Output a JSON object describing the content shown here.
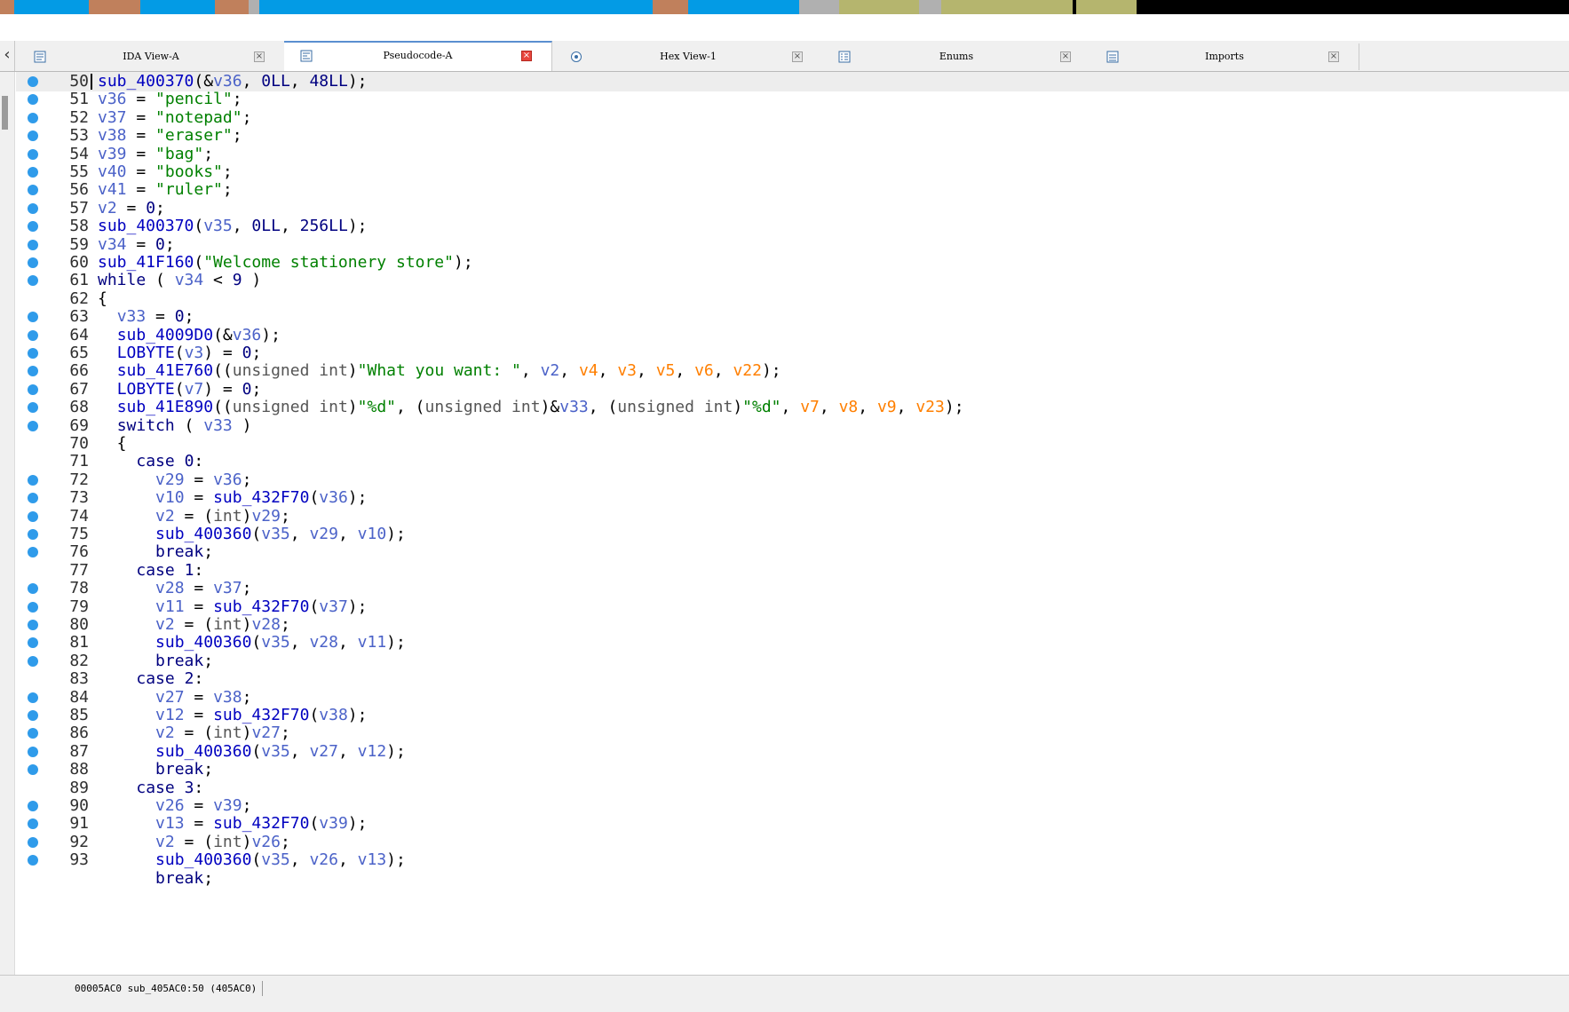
{
  "colors": {
    "nav_blue": "#039be5",
    "nav_brown": "#c0805c",
    "nav_olive": "#b5b56e",
    "nav_gray": "#b0b0b0",
    "nav_black": "#000000",
    "breakpoint_dot": "#2f9bea",
    "string": "#008000",
    "variable": "#4b62c8",
    "register_var": "#ff7f00"
  },
  "tabs": [
    {
      "label": "IDA View-A",
      "icon": "disassembly-icon",
      "active": false
    },
    {
      "label": "Pseudocode-A",
      "icon": "pseudocode-icon",
      "active": true
    },
    {
      "label": "Hex View-1",
      "icon": "hex-view-icon",
      "active": false
    },
    {
      "label": "Enums",
      "icon": "enums-icon",
      "active": false
    },
    {
      "label": "Imports",
      "icon": "imports-icon",
      "active": false
    }
  ],
  "code_lines": [
    {
      "n": "50",
      "dot": true,
      "tokens": [
        [
          "fn",
          "sub_400370"
        ],
        [
          "op",
          "(&"
        ],
        [
          "var",
          "v36"
        ],
        [
          "op",
          ", "
        ],
        [
          "num",
          "0LL"
        ],
        [
          "op",
          ", "
        ],
        [
          "num",
          "48LL"
        ],
        [
          "op",
          ");"
        ]
      ]
    },
    {
      "n": "51",
      "dot": true,
      "tokens": [
        [
          "var",
          "v36"
        ],
        [
          "op",
          " = "
        ],
        [
          "str",
          "\"pencil\""
        ],
        [
          "op",
          ";"
        ]
      ]
    },
    {
      "n": "52",
      "dot": true,
      "tokens": [
        [
          "var",
          "v37"
        ],
        [
          "op",
          " = "
        ],
        [
          "str",
          "\"notepad\""
        ],
        [
          "op",
          ";"
        ]
      ]
    },
    {
      "n": "53",
      "dot": true,
      "tokens": [
        [
          "var",
          "v38"
        ],
        [
          "op",
          " = "
        ],
        [
          "str",
          "\"eraser\""
        ],
        [
          "op",
          ";"
        ]
      ]
    },
    {
      "n": "54",
      "dot": true,
      "tokens": [
        [
          "var",
          "v39"
        ],
        [
          "op",
          " = "
        ],
        [
          "str",
          "\"bag\""
        ],
        [
          "op",
          ";"
        ]
      ]
    },
    {
      "n": "55",
      "dot": true,
      "tokens": [
        [
          "var",
          "v40"
        ],
        [
          "op",
          " = "
        ],
        [
          "str",
          "\"books\""
        ],
        [
          "op",
          ";"
        ]
      ]
    },
    {
      "n": "56",
      "dot": true,
      "tokens": [
        [
          "var",
          "v41"
        ],
        [
          "op",
          " = "
        ],
        [
          "str",
          "\"ruler\""
        ],
        [
          "op",
          ";"
        ]
      ]
    },
    {
      "n": "57",
      "dot": true,
      "tokens": [
        [
          "var",
          "v2"
        ],
        [
          "op",
          " = "
        ],
        [
          "num",
          "0"
        ],
        [
          "op",
          ";"
        ]
      ]
    },
    {
      "n": "58",
      "dot": true,
      "tokens": [
        [
          "fn",
          "sub_400370"
        ],
        [
          "op",
          "("
        ],
        [
          "var",
          "v35"
        ],
        [
          "op",
          ", "
        ],
        [
          "num",
          "0LL"
        ],
        [
          "op",
          ", "
        ],
        [
          "num",
          "256LL"
        ],
        [
          "op",
          ");"
        ]
      ]
    },
    {
      "n": "59",
      "dot": true,
      "tokens": [
        [
          "var",
          "v34"
        ],
        [
          "op",
          " = "
        ],
        [
          "num",
          "0"
        ],
        [
          "op",
          ";"
        ]
      ]
    },
    {
      "n": "60",
      "dot": true,
      "tokens": [
        [
          "fn",
          "sub_41F160"
        ],
        [
          "op",
          "("
        ],
        [
          "str",
          "\"Welcome stationery store\""
        ],
        [
          "op",
          ");"
        ]
      ]
    },
    {
      "n": "61",
      "dot": true,
      "tokens": [
        [
          "kw",
          "while"
        ],
        [
          "op",
          " ( "
        ],
        [
          "var",
          "v34"
        ],
        [
          "op",
          " < "
        ],
        [
          "num",
          "9"
        ],
        [
          "op",
          " )"
        ]
      ]
    },
    {
      "n": "62",
      "dot": false,
      "tokens": [
        [
          "op",
          "{"
        ]
      ]
    },
    {
      "n": "63",
      "dot": true,
      "tokens": [
        [
          "op",
          "  "
        ],
        [
          "var",
          "v33"
        ],
        [
          "op",
          " = "
        ],
        [
          "num",
          "0"
        ],
        [
          "op",
          ";"
        ]
      ]
    },
    {
      "n": "64",
      "dot": true,
      "tokens": [
        [
          "op",
          "  "
        ],
        [
          "fn",
          "sub_4009D0"
        ],
        [
          "op",
          "(&"
        ],
        [
          "var",
          "v36"
        ],
        [
          "op",
          ");"
        ]
      ]
    },
    {
      "n": "65",
      "dot": true,
      "tokens": [
        [
          "op",
          "  "
        ],
        [
          "fn",
          "LOBYTE"
        ],
        [
          "op",
          "("
        ],
        [
          "var",
          "v3"
        ],
        [
          "op",
          ") = "
        ],
        [
          "num",
          "0"
        ],
        [
          "op",
          ";"
        ]
      ]
    },
    {
      "n": "66",
      "dot": true,
      "tokens": [
        [
          "op",
          "  "
        ],
        [
          "fn",
          "sub_41E760"
        ],
        [
          "op",
          "(("
        ],
        [
          "typ",
          "unsigned int"
        ],
        [
          "op",
          ")"
        ],
        [
          "str",
          "\"What you want: \""
        ],
        [
          "op",
          ", "
        ],
        [
          "var",
          "v2"
        ],
        [
          "op",
          ", "
        ],
        [
          "reg",
          "v4"
        ],
        [
          "op",
          ", "
        ],
        [
          "reg",
          "v3"
        ],
        [
          "op",
          ", "
        ],
        [
          "reg",
          "v5"
        ],
        [
          "op",
          ", "
        ],
        [
          "reg",
          "v6"
        ],
        [
          "op",
          ", "
        ],
        [
          "reg",
          "v22"
        ],
        [
          "op",
          ");"
        ]
      ]
    },
    {
      "n": "67",
      "dot": true,
      "tokens": [
        [
          "op",
          "  "
        ],
        [
          "fn",
          "LOBYTE"
        ],
        [
          "op",
          "("
        ],
        [
          "var",
          "v7"
        ],
        [
          "op",
          ") = "
        ],
        [
          "num",
          "0"
        ],
        [
          "op",
          ";"
        ]
      ]
    },
    {
      "n": "68",
      "dot": true,
      "tokens": [
        [
          "op",
          "  "
        ],
        [
          "fn",
          "sub_41E890"
        ],
        [
          "op",
          "(("
        ],
        [
          "typ",
          "unsigned int"
        ],
        [
          "op",
          ")"
        ],
        [
          "str",
          "\"%d\""
        ],
        [
          "op",
          ", ("
        ],
        [
          "typ",
          "unsigned int"
        ],
        [
          "op",
          ")&"
        ],
        [
          "var",
          "v33"
        ],
        [
          "op",
          ", ("
        ],
        [
          "typ",
          "unsigned int"
        ],
        [
          "op",
          ")"
        ],
        [
          "str",
          "\"%d\""
        ],
        [
          "op",
          ", "
        ],
        [
          "reg",
          "v7"
        ],
        [
          "op",
          ", "
        ],
        [
          "reg",
          "v8"
        ],
        [
          "op",
          ", "
        ],
        [
          "reg",
          "v9"
        ],
        [
          "op",
          ", "
        ],
        [
          "reg",
          "v23"
        ],
        [
          "op",
          ");"
        ]
      ]
    },
    {
      "n": "69",
      "dot": true,
      "tokens": [
        [
          "op",
          "  "
        ],
        [
          "kw",
          "switch"
        ],
        [
          "op",
          " ( "
        ],
        [
          "var",
          "v33"
        ],
        [
          "op",
          " )"
        ]
      ]
    },
    {
      "n": "70",
      "dot": false,
      "tokens": [
        [
          "op",
          "  {"
        ]
      ]
    },
    {
      "n": "71",
      "dot": false,
      "tokens": [
        [
          "op",
          "    "
        ],
        [
          "kw",
          "case"
        ],
        [
          "op",
          " "
        ],
        [
          "num",
          "0"
        ],
        [
          "op",
          ":"
        ]
      ]
    },
    {
      "n": "72",
      "dot": true,
      "tokens": [
        [
          "op",
          "      "
        ],
        [
          "var",
          "v29"
        ],
        [
          "op",
          " = "
        ],
        [
          "var",
          "v36"
        ],
        [
          "op",
          ";"
        ]
      ]
    },
    {
      "n": "73",
      "dot": true,
      "tokens": [
        [
          "op",
          "      "
        ],
        [
          "var",
          "v10"
        ],
        [
          "op",
          " = "
        ],
        [
          "fn",
          "sub_432F70"
        ],
        [
          "op",
          "("
        ],
        [
          "var",
          "v36"
        ],
        [
          "op",
          ");"
        ]
      ]
    },
    {
      "n": "74",
      "dot": true,
      "tokens": [
        [
          "op",
          "      "
        ],
        [
          "var",
          "v2"
        ],
        [
          "op",
          " = ("
        ],
        [
          "typ",
          "int"
        ],
        [
          "op",
          ")"
        ],
        [
          "var",
          "v29"
        ],
        [
          "op",
          ";"
        ]
      ]
    },
    {
      "n": "75",
      "dot": true,
      "tokens": [
        [
          "op",
          "      "
        ],
        [
          "fn",
          "sub_400360"
        ],
        [
          "op",
          "("
        ],
        [
          "var",
          "v35"
        ],
        [
          "op",
          ", "
        ],
        [
          "var",
          "v29"
        ],
        [
          "op",
          ", "
        ],
        [
          "var",
          "v10"
        ],
        [
          "op",
          ");"
        ]
      ]
    },
    {
      "n": "76",
      "dot": true,
      "tokens": [
        [
          "op",
          "      "
        ],
        [
          "kw",
          "break"
        ],
        [
          "op",
          ";"
        ]
      ]
    },
    {
      "n": "77",
      "dot": false,
      "tokens": [
        [
          "op",
          "    "
        ],
        [
          "kw",
          "case"
        ],
        [
          "op",
          " "
        ],
        [
          "num",
          "1"
        ],
        [
          "op",
          ":"
        ]
      ]
    },
    {
      "n": "78",
      "dot": true,
      "tokens": [
        [
          "op",
          "      "
        ],
        [
          "var",
          "v28"
        ],
        [
          "op",
          " = "
        ],
        [
          "var",
          "v37"
        ],
        [
          "op",
          ";"
        ]
      ]
    },
    {
      "n": "79",
      "dot": true,
      "tokens": [
        [
          "op",
          "      "
        ],
        [
          "var",
          "v11"
        ],
        [
          "op",
          " = "
        ],
        [
          "fn",
          "sub_432F70"
        ],
        [
          "op",
          "("
        ],
        [
          "var",
          "v37"
        ],
        [
          "op",
          ");"
        ]
      ]
    },
    {
      "n": "80",
      "dot": true,
      "tokens": [
        [
          "op",
          "      "
        ],
        [
          "var",
          "v2"
        ],
        [
          "op",
          " = ("
        ],
        [
          "typ",
          "int"
        ],
        [
          "op",
          ")"
        ],
        [
          "var",
          "v28"
        ],
        [
          "op",
          ";"
        ]
      ]
    },
    {
      "n": "81",
      "dot": true,
      "tokens": [
        [
          "op",
          "      "
        ],
        [
          "fn",
          "sub_400360"
        ],
        [
          "op",
          "("
        ],
        [
          "var",
          "v35"
        ],
        [
          "op",
          ", "
        ],
        [
          "var",
          "v28"
        ],
        [
          "op",
          ", "
        ],
        [
          "var",
          "v11"
        ],
        [
          "op",
          ");"
        ]
      ]
    },
    {
      "n": "82",
      "dot": true,
      "tokens": [
        [
          "op",
          "      "
        ],
        [
          "kw",
          "break"
        ],
        [
          "op",
          ";"
        ]
      ]
    },
    {
      "n": "83",
      "dot": false,
      "tokens": [
        [
          "op",
          "    "
        ],
        [
          "kw",
          "case"
        ],
        [
          "op",
          " "
        ],
        [
          "num",
          "2"
        ],
        [
          "op",
          ":"
        ]
      ]
    },
    {
      "n": "84",
      "dot": true,
      "tokens": [
        [
          "op",
          "      "
        ],
        [
          "var",
          "v27"
        ],
        [
          "op",
          " = "
        ],
        [
          "var",
          "v38"
        ],
        [
          "op",
          ";"
        ]
      ]
    },
    {
      "n": "85",
      "dot": true,
      "tokens": [
        [
          "op",
          "      "
        ],
        [
          "var",
          "v12"
        ],
        [
          "op",
          " = "
        ],
        [
          "fn",
          "sub_432F70"
        ],
        [
          "op",
          "("
        ],
        [
          "var",
          "v38"
        ],
        [
          "op",
          ");"
        ]
      ]
    },
    {
      "n": "86",
      "dot": true,
      "tokens": [
        [
          "op",
          "      "
        ],
        [
          "var",
          "v2"
        ],
        [
          "op",
          " = ("
        ],
        [
          "typ",
          "int"
        ],
        [
          "op",
          ")"
        ],
        [
          "var",
          "v27"
        ],
        [
          "op",
          ";"
        ]
      ]
    },
    {
      "n": "87",
      "dot": true,
      "tokens": [
        [
          "op",
          "      "
        ],
        [
          "fn",
          "sub_400360"
        ],
        [
          "op",
          "("
        ],
        [
          "var",
          "v35"
        ],
        [
          "op",
          ", "
        ],
        [
          "var",
          "v27"
        ],
        [
          "op",
          ", "
        ],
        [
          "var",
          "v12"
        ],
        [
          "op",
          ");"
        ]
      ]
    },
    {
      "n": "88",
      "dot": true,
      "tokens": [
        [
          "op",
          "      "
        ],
        [
          "kw",
          "break"
        ],
        [
          "op",
          ";"
        ]
      ]
    },
    {
      "n": "89",
      "dot": false,
      "tokens": [
        [
          "op",
          "    "
        ],
        [
          "kw",
          "case"
        ],
        [
          "op",
          " "
        ],
        [
          "num",
          "3"
        ],
        [
          "op",
          ":"
        ]
      ]
    },
    {
      "n": "90",
      "dot": true,
      "tokens": [
        [
          "op",
          "      "
        ],
        [
          "var",
          "v26"
        ],
        [
          "op",
          " = "
        ],
        [
          "var",
          "v39"
        ],
        [
          "op",
          ";"
        ]
      ]
    },
    {
      "n": "91",
      "dot": true,
      "tokens": [
        [
          "op",
          "      "
        ],
        [
          "var",
          "v13"
        ],
        [
          "op",
          " = "
        ],
        [
          "fn",
          "sub_432F70"
        ],
        [
          "op",
          "("
        ],
        [
          "var",
          "v39"
        ],
        [
          "op",
          ");"
        ]
      ]
    },
    {
      "n": "92",
      "dot": true,
      "tokens": [
        [
          "op",
          "      "
        ],
        [
          "var",
          "v2"
        ],
        [
          "op",
          " = ("
        ],
        [
          "typ",
          "int"
        ],
        [
          "op",
          ")"
        ],
        [
          "var",
          "v26"
        ],
        [
          "op",
          ";"
        ]
      ]
    },
    {
      "n": "93",
      "dot": true,
      "tokens": [
        [
          "op",
          "      "
        ],
        [
          "fn",
          "sub_400360"
        ],
        [
          "op",
          "("
        ],
        [
          "var",
          "v35"
        ],
        [
          "op",
          ", "
        ],
        [
          "var",
          "v26"
        ],
        [
          "op",
          ", "
        ],
        [
          "var",
          "v13"
        ],
        [
          "op",
          ");"
        ]
      ]
    },
    {
      "n": "",
      "dot": false,
      "tokens": [
        [
          "op",
          "      "
        ],
        [
          "kw",
          "break"
        ],
        [
          "op",
          ";"
        ]
      ]
    }
  ],
  "status_bar": {
    "location": "00005AC0 sub_405AC0:50 (405AC0)"
  }
}
